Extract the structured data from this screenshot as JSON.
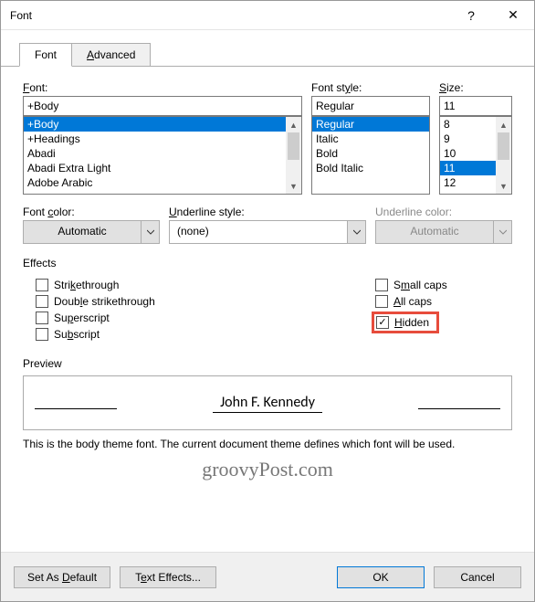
{
  "titlebar": {
    "title": "Font"
  },
  "tabs": {
    "font": "Font",
    "advanced": "Advanced",
    "active": "Font"
  },
  "font_section": {
    "label": "Font:",
    "value": "+Body",
    "items": [
      "+Body",
      "+Headings",
      "Abadi",
      "Abadi Extra Light",
      "Adobe Arabic"
    ],
    "selected": "+Body"
  },
  "fontstyle_section": {
    "label": "Font style:",
    "value": "Regular",
    "items": [
      "Regular",
      "Italic",
      "Bold",
      "Bold Italic"
    ],
    "selected": "Regular"
  },
  "size_section": {
    "label": "Size:",
    "value": "11",
    "items": [
      "8",
      "9",
      "10",
      "11",
      "12"
    ],
    "selected": "11"
  },
  "font_color": {
    "label": "Font color:",
    "value": "Automatic"
  },
  "underline_style": {
    "label": "Underline style:",
    "value": "(none)"
  },
  "underline_color": {
    "label": "Underline color:",
    "value": "Automatic"
  },
  "effects": {
    "title": "Effects",
    "strikethrough": "Strikethrough",
    "double_strikethrough": "Double strikethrough",
    "superscript": "Superscript",
    "subscript": "Subscript",
    "small_caps": "Small caps",
    "all_caps": "All caps",
    "hidden": "Hidden",
    "hidden_checked": true
  },
  "preview": {
    "title": "Preview",
    "sample": "John F. Kennedy",
    "description": "This is the body theme font. The current document theme defines which font will be used."
  },
  "footer": {
    "set_default": "Set As Default",
    "text_effects": "Text Effects...",
    "ok": "OK",
    "cancel": "Cancel"
  },
  "watermark": "groovyPost.com"
}
